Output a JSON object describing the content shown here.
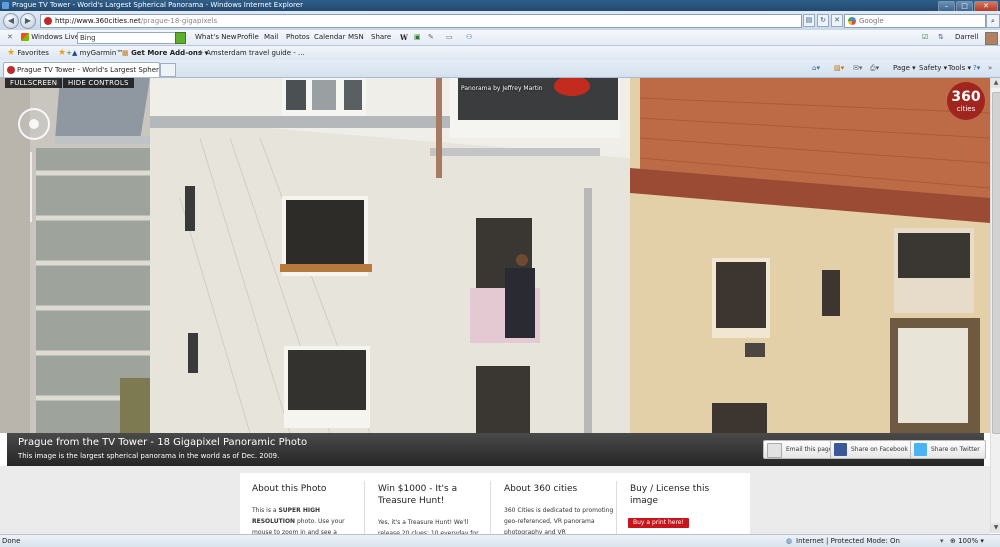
{
  "window": {
    "title": "Prague TV Tower - World's Largest Spherical Panorama - Windows Internet Explorer"
  },
  "address": {
    "url_domain": "http://www.360cities.net",
    "url_path": "/prague-18-gigapixels"
  },
  "search": {
    "placeholder": "Google"
  },
  "live_bar": {
    "brand": "Windows Live",
    "search_value": "Bing",
    "links": [
      "What's New",
      "Profile",
      "Mail",
      "Photos",
      "Calendar",
      "MSN",
      "Share"
    ],
    "user": "Darrell"
  },
  "favorites_bar": {
    "favorites_label": "Favorites",
    "items": [
      "myGarmin™",
      "Get More Add-ons",
      "Amsterdam travel guide - ..."
    ]
  },
  "tab": {
    "title": "Prague TV Tower - World's Largest Spherical Pano..."
  },
  "tools": {
    "page": "Page",
    "safety": "Safety",
    "tools": "Tools"
  },
  "panorama": {
    "fullscreen": "FULLSCREEN",
    "hide_controls": "HIDE CONTROLS",
    "credit": "Panorama by Jeffrey Martin",
    "logo_number": "360",
    "logo_word": "cities"
  },
  "info": {
    "heading": "Prague from the TV Tower - 18 Gigapixel Panoramic Photo",
    "subheading": "This image is the largest spherical panorama in the world as of Dec. 2009.",
    "share": [
      "Email this page",
      "Share on Facebook",
      "Share on Twitter"
    ]
  },
  "columns": [
    {
      "heading": "About this Photo",
      "body_prefix": "This is a ",
      "body_bold": "SUPER HIGH RESOLUTION",
      "body_suffix": " photo. Use your mouse to zoom in and see a"
    },
    {
      "heading": "Win $1000 - It's a Treasure Hunt!",
      "body": "Yes, it's a Treasure Hunt! We'll release 20 clues; 10 everyday for"
    },
    {
      "heading": "About 360 cities",
      "body": "360 Cities is dedicated to promoting geo-referenced, VR panorama photography and VR"
    },
    {
      "heading": "Buy / License this image",
      "button": "Buy a print here!"
    }
  ],
  "status": {
    "left": "Done",
    "zone": "Internet | Protected Mode: On",
    "zoom": "100%"
  },
  "colors": {
    "accent_red": "#c8151c",
    "infobar": "#262626",
    "ie_blue": "#23496f"
  }
}
